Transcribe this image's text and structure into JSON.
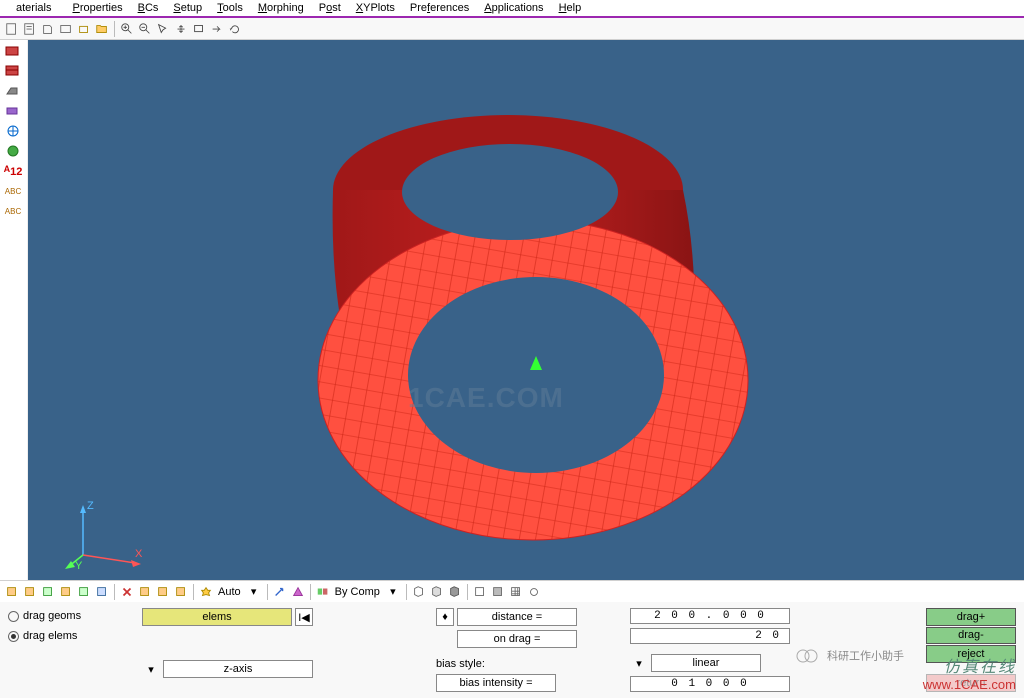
{
  "menubar": {
    "items": [
      "aterials",
      "Properties",
      "BCs",
      "Setup",
      "Tools",
      "Morphing",
      "Post",
      "XYPlots",
      "Preferences",
      "Applications",
      "Help"
    ],
    "underlines": [
      "a",
      "P",
      "B",
      "S",
      "T",
      "M",
      "P",
      "X",
      "P",
      "A",
      "H"
    ]
  },
  "toolbar_top": {
    "icons": [
      "new",
      "new2",
      "open",
      "open2",
      "open3",
      "folder",
      "sep",
      "zoom-in",
      "zoom-out",
      "arrow",
      "pan",
      "rect",
      "arrow2",
      "rotate"
    ]
  },
  "left_tools": {
    "icons": [
      "red1",
      "red2",
      "cube",
      "purple",
      "globe",
      "green",
      "a12",
      "abc1",
      "abc2"
    ]
  },
  "viewport": {
    "watermark": "1CAE.COM",
    "axis": {
      "z": "Z",
      "x": "X",
      "y": "Y"
    }
  },
  "toolbar_mid": {
    "icons": [
      "t1",
      "t2",
      "t3",
      "t4",
      "t5",
      "t6",
      "sep",
      "x",
      "clip",
      "cp2",
      "cp3",
      "auto",
      "sep2",
      "down",
      "arrow3d",
      "tri",
      "sep3",
      "bycomp",
      "sep4",
      "w1",
      "w2",
      "w3",
      "sep5",
      "box1",
      "box2",
      "grid",
      "tool"
    ]
  },
  "toolbar_mid_labels": {
    "auto": "Auto",
    "bycomp": "By Comp"
  },
  "panel": {
    "radio1": "drag geoms",
    "radio2": "drag elems",
    "elems_btn": "elems",
    "zaxis_btn": "z-axis",
    "distance_lbl": "distance =",
    "distance_val": "2 0 0 . 0 0 0",
    "ondrag_lbl": "on drag =",
    "ondrag_val": "2 0",
    "bias_style_lbl": "bias style:",
    "bias_style_val": "linear",
    "bias_int_lbl": "bias intensity =",
    "bias_int_val": "0  1 0 0 0",
    "drag_plus": "drag+",
    "drag_minus": "drag-",
    "reject": "reject",
    "return": "return"
  },
  "watermarks": {
    "bubble": "科研工作小助手",
    "zh": "仿真在线",
    "url": "www.1CAE.com"
  }
}
